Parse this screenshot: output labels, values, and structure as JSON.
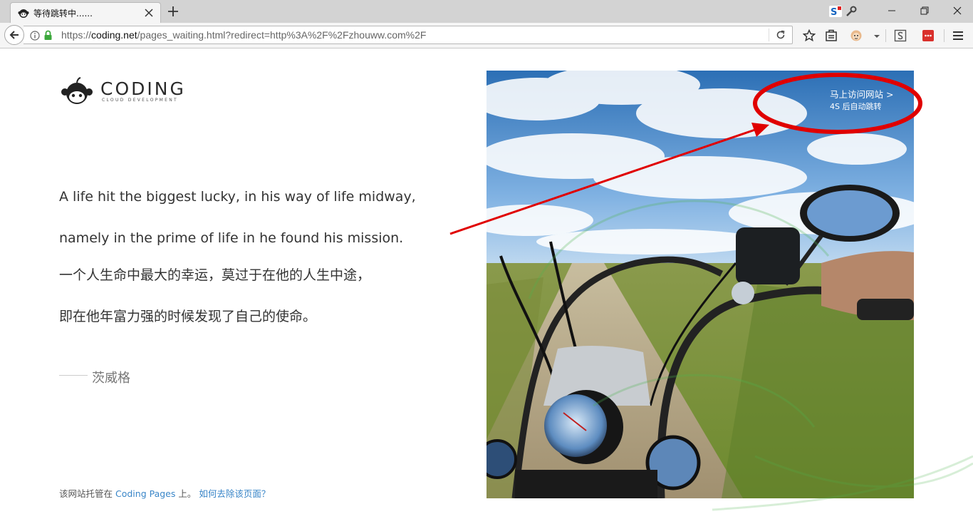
{
  "browser": {
    "tab_title": "等待跳转中......",
    "url": {
      "scheme": "https://",
      "host": "coding.net",
      "path": "/pages_waiting.html?redirect=http%3A%2F%2Fzhouww.com%2F"
    },
    "extension_badge": "S"
  },
  "page": {
    "logo": {
      "word": "CODING",
      "tagline": "CLOUD DEVELOPMENT"
    },
    "quote": {
      "en_line1": "A life hit the biggest lucky, in his way of life midway,",
      "en_line2": "namely in the prime of life in he found his mission.",
      "zh_line1": "一个人生命中最大的幸运，莫过于在他的人生中途，",
      "zh_line2": "即在他年富力强的时候发现了自己的使命。",
      "author": "茨威格"
    },
    "redirect": {
      "visit_label": "马上访问网站 >",
      "countdown": "4S 后自动跳转"
    },
    "footer": {
      "prefix": "该网站托管在 ",
      "host_link": "Coding Pages",
      "suffix": " 上。 ",
      "remove_link": "如何去除该页面？"
    }
  },
  "colors": {
    "link": "#3a86c8",
    "annotation": "#e00000"
  }
}
